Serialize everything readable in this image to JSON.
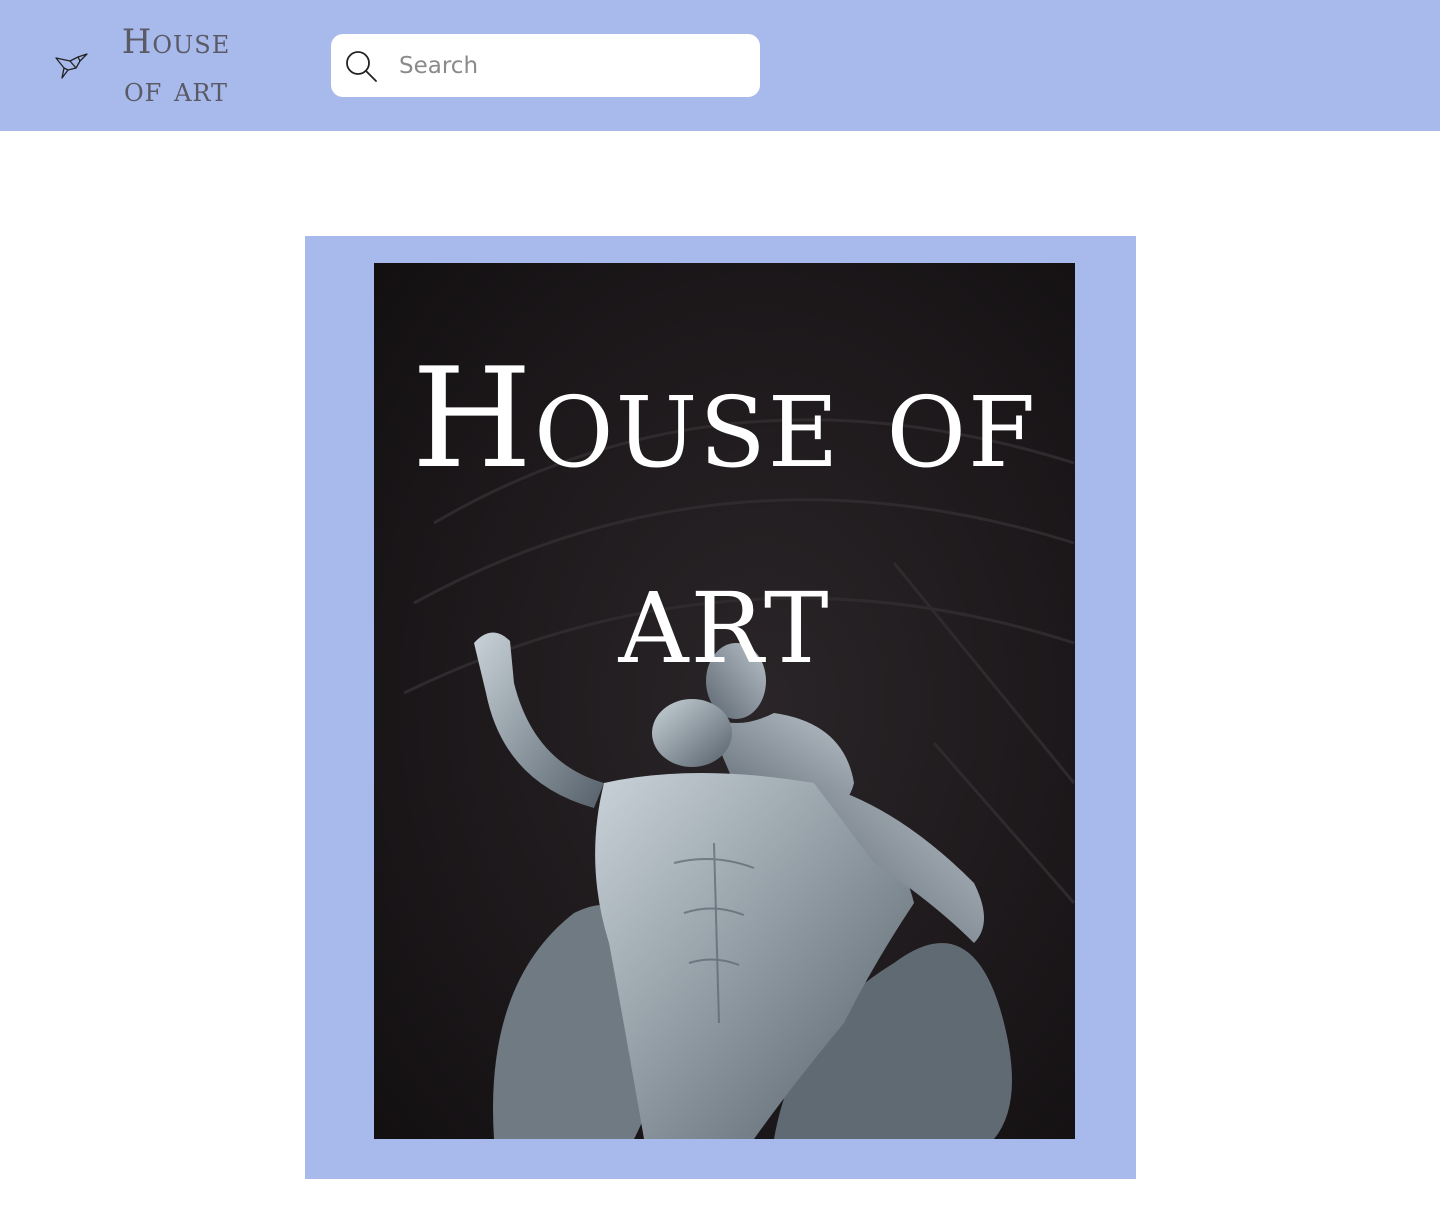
{
  "header": {
    "logo_icon": "origami-bird-icon",
    "logo_text": "House of art",
    "background": "#a8baec"
  },
  "search": {
    "icon": "search-icon",
    "placeholder": "Search"
  },
  "hero": {
    "title": "House of art",
    "frame_color": "#a8baec",
    "image": "marble-statue-sculpture"
  }
}
